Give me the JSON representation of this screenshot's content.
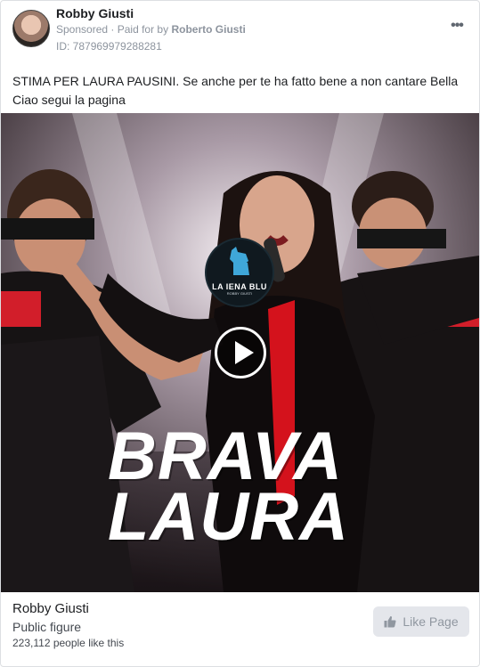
{
  "post": {
    "page_name": "Robby Giusti",
    "sponsored_label": "Sponsored",
    "separator": "·",
    "paid_for_prefix": "Paid for by",
    "paid_for_name": "Roberto Giusti",
    "ad_id": "ID: 787969979288281",
    "body_text": "STIMA PER LAURA PAUSINI. Se anche per te ha fatto bene a non cantare Bella Ciao segui la pagina"
  },
  "media": {
    "logo_text_top": "LA IENA BLU",
    "logo_text_small": "ROBBY GIUSTI",
    "headline_line1": "BRAVA",
    "headline_line2": "LAURA",
    "play_icon": "play-icon"
  },
  "footer": {
    "page_name": "Robby Giusti",
    "category": "Public figure",
    "likes": "223,112 people like this",
    "like_button_label": "Like Page",
    "like_icon": "thumbs-up-icon"
  },
  "colors": {
    "muted_text": "#8d949e",
    "button_bg": "#e4e6eb",
    "button_text": "#9097a0"
  }
}
